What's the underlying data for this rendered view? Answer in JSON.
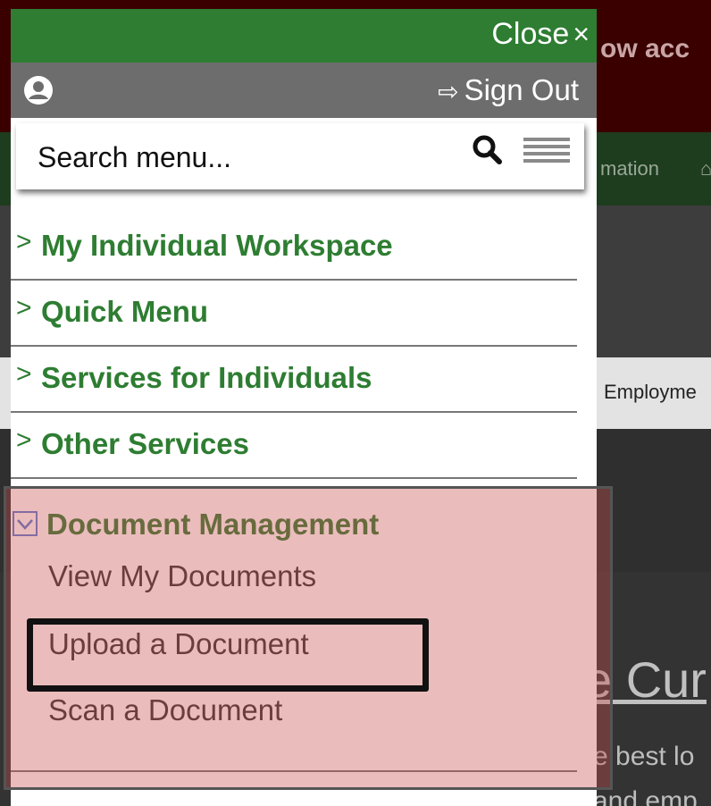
{
  "background": {
    "banner_text": "ow acc",
    "nav_text": "mation",
    "tab_text": "Employme",
    "heading": "e Cur",
    "body_line1": "e best lo",
    "body_line2": "and emp"
  },
  "menu": {
    "close_label": "Close",
    "close_symbol": "×",
    "signout_icon": "⇨",
    "signout_label": "Sign Out",
    "search_placeholder": "Search menu...",
    "items": [
      {
        "chevron": ">",
        "label": "My Individual Workspace"
      },
      {
        "chevron": ">",
        "label": "Quick Menu"
      },
      {
        "chevron": ">",
        "label": "Services for Individuals"
      },
      {
        "chevron": ">",
        "label": "Other Services"
      }
    ],
    "document_management": {
      "label": "Document Management",
      "expanded": true,
      "subitems": [
        {
          "label": "View My Documents"
        },
        {
          "label": "Upload a Document"
        },
        {
          "label": "Scan a Document"
        }
      ]
    }
  },
  "colors": {
    "accent_green": "#2e7d32",
    "user_bar_gray": "#6d6d6d",
    "highlight": "rgba(200,80,80,0.38)"
  },
  "icons": [
    "user-circle-icon",
    "sign-out-icon",
    "search-icon",
    "hamburger-icon",
    "chevron-right-icon",
    "chevron-down-icon",
    "close-icon"
  ]
}
